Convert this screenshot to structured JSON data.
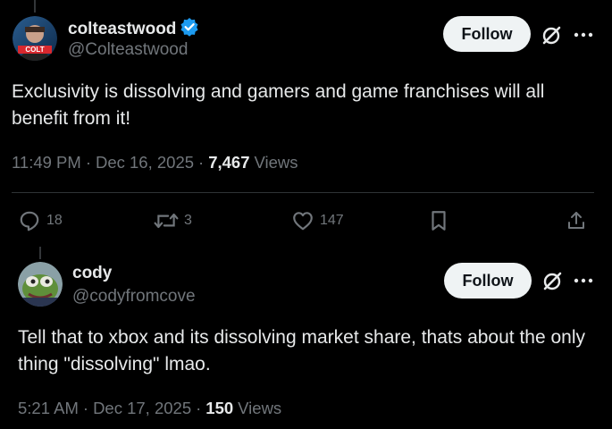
{
  "post1": {
    "display_name": "colteastwood",
    "handle": "@Colteastwood",
    "verified": true,
    "avatar_text": "COLT",
    "follow_label": "Follow",
    "text": "Exclusivity is dissolving and gamers and game franchises will all benefit from it!",
    "time": "11:49 PM",
    "date": "Dec 16, 2025",
    "views_count": "7,467",
    "views_label": "Views",
    "replies": "18",
    "reposts": "3",
    "likes": "147"
  },
  "post2": {
    "display_name": "cody",
    "handle": "@codyfromcove",
    "follow_label": "Follow",
    "text": "Tell that to xbox and its dissolving market share, thats about the only thing \"dissolving\" lmao.",
    "time": "5:21 AM",
    "date": "Dec 17, 2025",
    "views_count": "150",
    "views_label": "Views"
  },
  "colors": {
    "background": "#000000",
    "text_primary": "#e7e9ea",
    "text_secondary": "#71767b",
    "verified_blue": "#1d9bf0",
    "follow_bg": "#eff3f4",
    "divider": "#2f3336"
  },
  "icons": {
    "verified": "verified-badge-icon",
    "grok": "grok-icon",
    "more": "more-dots-icon",
    "reply": "reply-icon",
    "repost": "repost-icon",
    "like": "heart-icon",
    "bookmark": "bookmark-icon",
    "share": "share-icon"
  }
}
